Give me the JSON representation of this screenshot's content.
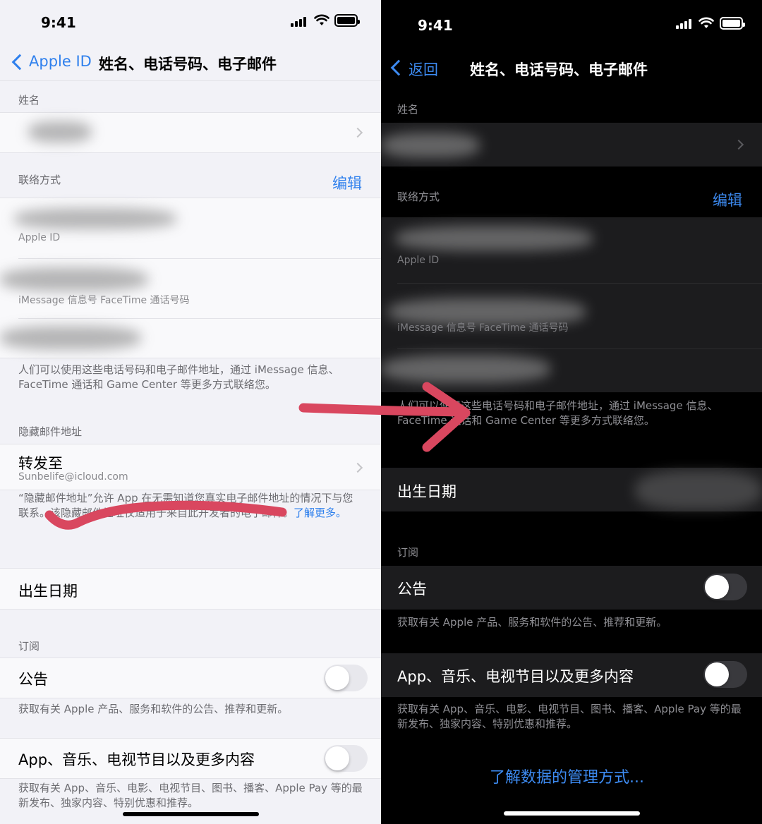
{
  "light": {
    "status_bar": {
      "time": "9:41"
    },
    "nav": {
      "back_label": "Apple ID",
      "title": "姓名、电话号码、电子邮件"
    },
    "name_section": {
      "header": "姓名"
    },
    "contact_section": {
      "header": "联络方式",
      "edit_label": "编辑",
      "rows": [
        {
          "caption": "Apple ID"
        },
        {
          "caption": "iMessage 信息号 FaceTime 通话号码"
        }
      ],
      "footer": "人们可以使用这些电话号码和电子邮件地址，通过 iMessage 信息、FaceTime 通话和 Game Center 等更多方式联络您。"
    },
    "hide_mail_section": {
      "header": "隐藏邮件地址",
      "forward_label": "转发至",
      "forward_email": "Sunbelife@icloud.com",
      "footer": "“隐藏邮件地址”允许 App 在无需知道您真实电子邮件地址的情况下与您联系。该隐藏邮件地址仅适用于来自此开发者的电子邮件。",
      "learn_more": "了解更多。"
    },
    "birthday_label": "出生日期",
    "subscribe_section": {
      "header": "订阅",
      "announcements": {
        "label": "公告",
        "on": false,
        "footer": "获取有关 Apple 产品、服务和软件的公告、推荐和更新。"
      },
      "media": {
        "label": "App、音乐、电视节目以及更多内容",
        "on": false,
        "footer": "获取有关 App、音乐、电影、电视节目、图书、播客、Apple Pay 等的最新发布、独家内容、特别优惠和推荐。"
      }
    }
  },
  "dark": {
    "status_bar": {
      "time": "9:41"
    },
    "nav": {
      "back_label": "返回",
      "title": "姓名、电话号码、电子邮件"
    },
    "name_section": {
      "header": "姓名"
    },
    "contact_section": {
      "header": "联络方式",
      "edit_label": "编辑",
      "rows": [
        {
          "caption": "Apple ID"
        },
        {
          "caption": "iMessage 信息号 FaceTime 通话号码"
        }
      ],
      "footer": "人们可以使用这些电话号码和电子邮件地址，通过 iMessage 信息、FaceTime 通话和 Game Center 等更多方式联络您。"
    },
    "birthday_label": "出生日期",
    "subscribe_section": {
      "header": "订阅",
      "announcements": {
        "label": "公告",
        "on": false,
        "footer": "获取有关 Apple 产品、服务和软件的公告、推荐和更新。"
      },
      "media": {
        "label": "App、音乐、电视节目以及更多内容",
        "on": false,
        "footer": "获取有关 App、音乐、电影、电视节目、图书、播客、Apple Pay 等的最新发布、独家内容、特别优惠和推荐。"
      }
    },
    "data_link": "了解数据的管理方式..."
  },
  "colors": {
    "accent_blue": "#2f80ed",
    "annotation_red": "#d9475f"
  }
}
